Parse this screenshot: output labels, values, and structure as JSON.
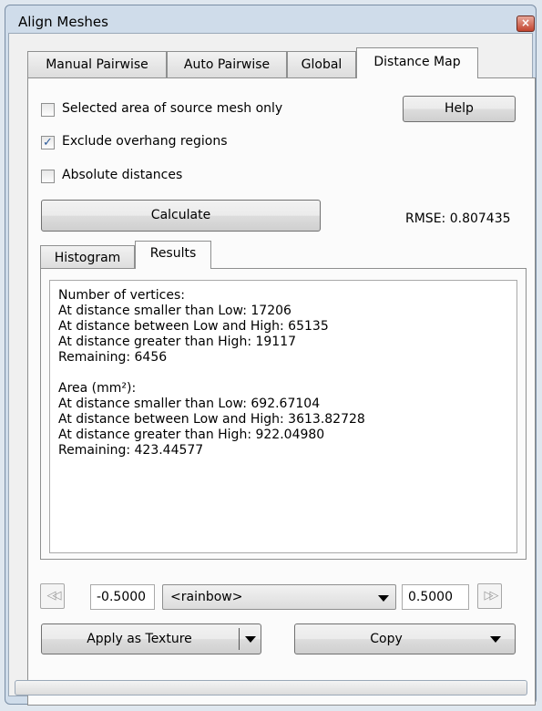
{
  "window": {
    "title": "Align Meshes",
    "close_glyph": "×"
  },
  "tabs": [
    {
      "label": "Manual Pairwise"
    },
    {
      "label": "Auto Pairwise"
    },
    {
      "label": "Global"
    },
    {
      "label": "Distance Map",
      "active": true
    }
  ],
  "options": {
    "selected_area": {
      "label": "Selected area of source mesh only",
      "checked": false
    },
    "exclude_overhang": {
      "label": "Exclude overhang regions",
      "checked": true
    },
    "absolute_distances": {
      "label": "Absolute distances",
      "checked": false
    }
  },
  "buttons": {
    "help": "Help",
    "calculate": "Calculate"
  },
  "rmse": "RMSE: 0.807435",
  "subtabs": [
    {
      "label": "Histogram"
    },
    {
      "label": "Results",
      "active": true
    }
  ],
  "results": {
    "vertices": {
      "header": "Number of vertices:",
      "lines": [
        "At distance smaller than Low: 17206",
        "At distance between Low and High: 65135",
        "At distance greater than High: 19117",
        "Remaining: 6456"
      ]
    },
    "area": {
      "header": "Area (mm²):",
      "lines": [
        "At distance smaller than Low: 692.67104",
        "At distance between Low and High: 3613.82728",
        "At distance greater than High: 922.04980",
        "Remaining: 423.44577"
      ]
    }
  },
  "range": {
    "low_value": "-0.5000",
    "colormap": "<rainbow>",
    "high_value": "0.5000",
    "first_icon": "skip-to-start-icon",
    "last_icon": "skip-to-end-icon"
  },
  "actions": {
    "apply_texture": "Apply as Texture",
    "copy": "Copy"
  }
}
